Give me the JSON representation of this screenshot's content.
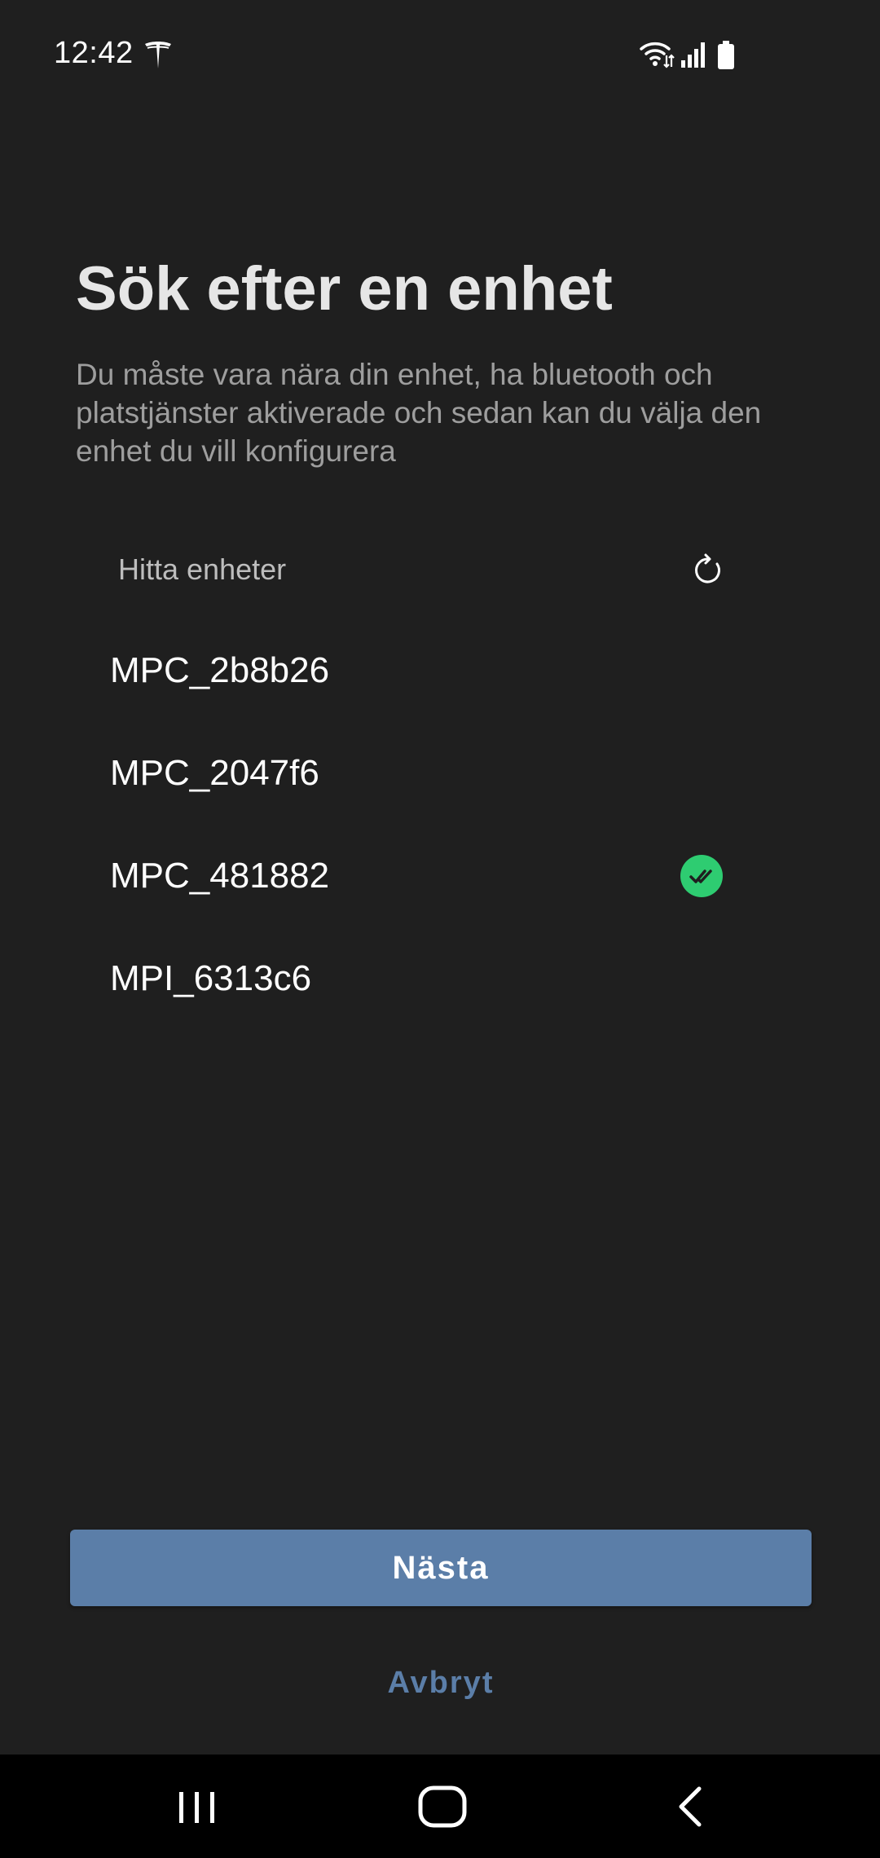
{
  "status_bar": {
    "time": "12:42",
    "icons": [
      "tesla-icon",
      "wifi-icon",
      "signal-icon",
      "battery-icon"
    ]
  },
  "page": {
    "title": "Sök efter en enhet",
    "description": "Du måste vara nära din enhet, ha bluetooth och platstjänster aktiverade och sedan kan du välja den enhet du vill konfigurera"
  },
  "device_search": {
    "label": "Hitta enheter",
    "refresh_icon": "refresh-icon"
  },
  "devices": [
    {
      "name": "MPC_2b8b26",
      "selected": false
    },
    {
      "name": "MPC_2047f6",
      "selected": false
    },
    {
      "name": "MPC_481882",
      "selected": true
    },
    {
      "name": "MPI_6313c6",
      "selected": false
    }
  ],
  "actions": {
    "next_label": "Nästa",
    "cancel_label": "Avbryt"
  },
  "colors": {
    "background": "#1f1f1f",
    "accent": "#5b7ea8",
    "selected_check": "#2ecc71"
  },
  "nav_bar": {
    "icons": [
      "recents-icon",
      "home-icon",
      "back-icon"
    ]
  }
}
